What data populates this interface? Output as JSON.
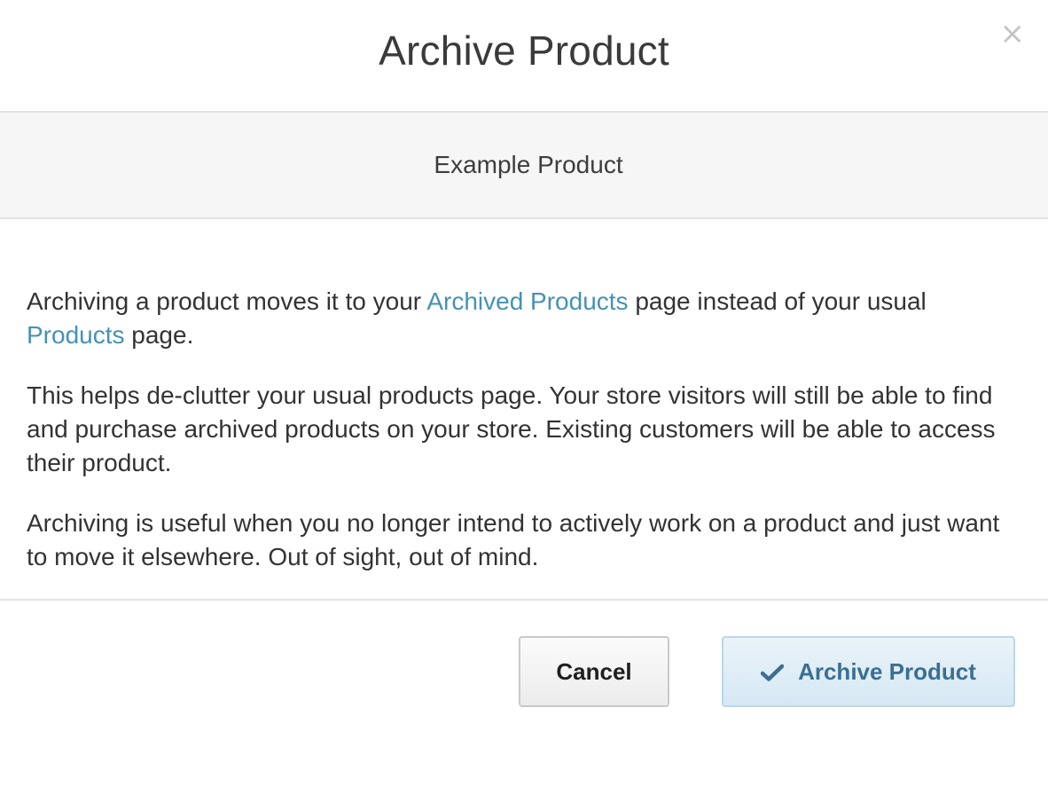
{
  "dialog": {
    "title": "Archive Product",
    "close_label": "×"
  },
  "product": {
    "name": "Example Product"
  },
  "body": {
    "p1_before": "Archiving a product moves it to your ",
    "p1_link1": "Archived Products",
    "p1_middle": " page instead of your usual ",
    "p1_link2": "Products",
    "p1_after": " page.",
    "p2": "This helps de-clutter your usual products page. Your store visitors will still be able to find and purchase archived products on your store. Existing customers will be able to access their product.",
    "p3": "Archiving is useful when you no longer intend to actively work on a product and just want to move it elsewhere. Out of sight, out of mind."
  },
  "footer": {
    "cancel_label": "Cancel",
    "archive_label": "Archive Product",
    "archive_icon": "checkmark-icon"
  },
  "colors": {
    "link": "#4592b3",
    "primary_button_text": "#3a6f92",
    "primary_button_bg": "#d6e8f3"
  }
}
